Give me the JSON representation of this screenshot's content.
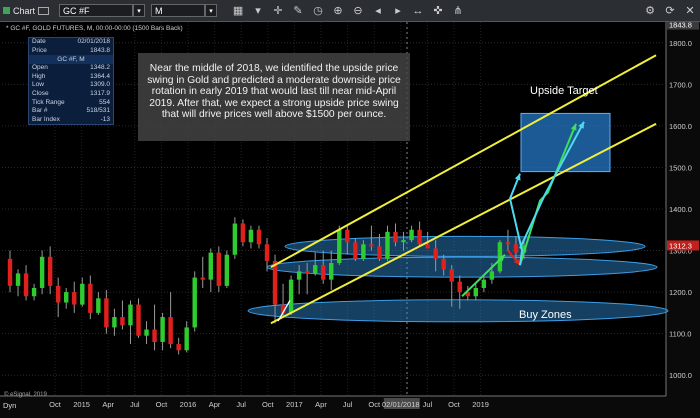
{
  "toolbar": {
    "app_label": "Chart",
    "symbol": "GC #F",
    "interval": "M"
  },
  "series_label": "* GC #F, GOLD FUTURES, M, 00:00-00:00 (1500 Bars Back)",
  "data_window": {
    "rows": [
      {
        "k": "Date",
        "v": "02/01/2018"
      },
      {
        "k": "Price",
        "v": "1843.8"
      }
    ],
    "header": "GC #F, M",
    "rows2": [
      {
        "k": "Open",
        "v": "1348.2"
      },
      {
        "k": "High",
        "v": "1364.4"
      },
      {
        "k": "Low",
        "v": "1309.0"
      },
      {
        "k": "Close",
        "v": "1317.9"
      },
      {
        "k": "Tick Range",
        "v": "554"
      },
      {
        "k": "Bar #",
        "v": "518/531"
      },
      {
        "k": "Bar Index",
        "v": "-13"
      }
    ]
  },
  "annotation": "Near the middle of 2018, we identified the upside price swing in Gold and predicted a moderate downside price rotation in early 2019 that would last till near mid-April 2019.  After that, we expect a strong upside price swing that will drive prices well above $1500 per ounce.",
  "upside_label": "Upside Target",
  "buy_label": "Buy Zones",
  "watermark": "© eSignal, 2019",
  "bottom_left": "Dyn",
  "colors": {
    "up": "#2ecc2e",
    "down": "#e0201c",
    "channel": "#f2ef3a",
    "zone": "#2f8fd8",
    "arrow_green": "#3de05a",
    "arrow_cyan": "#4fd8f2"
  },
  "chart_data": {
    "type": "candlestick",
    "ylim": [
      950,
      1850
    ],
    "y_ticks": [
      1000,
      1100,
      1200,
      1300,
      1400,
      1500,
      1600,
      1700,
      1800
    ],
    "y_tick_labels": [
      "1000.0",
      "1100.0",
      "1200.0",
      "1300.0",
      "1400.0",
      "1500.0",
      "1600.0",
      "1700.0",
      "1800.0"
    ],
    "price_marker_top": "1843.8",
    "price_marker_last": "1312.3",
    "x_tick_labels": [
      "Oct",
      "2015",
      "Apr",
      "Jul",
      "Oct",
      "2016",
      "Apr",
      "Jul",
      "Oct",
      "2017",
      "Apr",
      "Jul",
      "Oct",
      "02/01/2018",
      "Jul",
      "Oct",
      "2019"
    ],
    "grid": true,
    "candles": [
      {
        "o": 1280,
        "h": 1300,
        "l": 1200,
        "c": 1215
      },
      {
        "o": 1215,
        "h": 1255,
        "l": 1190,
        "c": 1245
      },
      {
        "o": 1245,
        "h": 1265,
        "l": 1180,
        "c": 1190
      },
      {
        "o": 1190,
        "h": 1220,
        "l": 1180,
        "c": 1210
      },
      {
        "o": 1210,
        "h": 1300,
        "l": 1195,
        "c": 1285
      },
      {
        "o": 1285,
        "h": 1310,
        "l": 1195,
        "c": 1215
      },
      {
        "o": 1215,
        "h": 1235,
        "l": 1140,
        "c": 1175
      },
      {
        "o": 1175,
        "h": 1210,
        "l": 1160,
        "c": 1200
      },
      {
        "o": 1200,
        "h": 1225,
        "l": 1150,
        "c": 1170
      },
      {
        "o": 1170,
        "h": 1235,
        "l": 1165,
        "c": 1220
      },
      {
        "o": 1220,
        "h": 1240,
        "l": 1135,
        "c": 1150
      },
      {
        "o": 1150,
        "h": 1200,
        "l": 1145,
        "c": 1185
      },
      {
        "o": 1185,
        "h": 1205,
        "l": 1100,
        "c": 1115
      },
      {
        "o": 1115,
        "h": 1160,
        "l": 1095,
        "c": 1140
      },
      {
        "o": 1140,
        "h": 1180,
        "l": 1110,
        "c": 1120
      },
      {
        "o": 1120,
        "h": 1180,
        "l": 1075,
        "c": 1170
      },
      {
        "o": 1170,
        "h": 1185,
        "l": 1090,
        "c": 1095
      },
      {
        "o": 1095,
        "h": 1130,
        "l": 1075,
        "c": 1110
      },
      {
        "o": 1110,
        "h": 1170,
        "l": 1060,
        "c": 1080
      },
      {
        "o": 1080,
        "h": 1150,
        "l": 1060,
        "c": 1140
      },
      {
        "o": 1140,
        "h": 1200,
        "l": 1065,
        "c": 1075
      },
      {
        "o": 1075,
        "h": 1090,
        "l": 1050,
        "c": 1060
      },
      {
        "o": 1060,
        "h": 1130,
        "l": 1055,
        "c": 1115
      },
      {
        "o": 1115,
        "h": 1250,
        "l": 1105,
        "c": 1235
      },
      {
        "o": 1235,
        "h": 1285,
        "l": 1210,
        "c": 1230
      },
      {
        "o": 1230,
        "h": 1305,
        "l": 1200,
        "c": 1295
      },
      {
        "o": 1295,
        "h": 1310,
        "l": 1200,
        "c": 1215
      },
      {
        "o": 1215,
        "h": 1300,
        "l": 1210,
        "c": 1290
      },
      {
        "o": 1290,
        "h": 1380,
        "l": 1280,
        "c": 1365
      },
      {
        "o": 1365,
        "h": 1375,
        "l": 1310,
        "c": 1320
      },
      {
        "o": 1320,
        "h": 1360,
        "l": 1305,
        "c": 1350
      },
      {
        "o": 1350,
        "h": 1360,
        "l": 1305,
        "c": 1315
      },
      {
        "o": 1315,
        "h": 1330,
        "l": 1250,
        "c": 1275
      },
      {
        "o": 1275,
        "h": 1290,
        "l": 1125,
        "c": 1170
      },
      {
        "o": 1170,
        "h": 1220,
        "l": 1140,
        "c": 1150
      },
      {
        "o": 1150,
        "h": 1240,
        "l": 1145,
        "c": 1230
      },
      {
        "o": 1230,
        "h": 1265,
        "l": 1195,
        "c": 1250
      },
      {
        "o": 1250,
        "h": 1270,
        "l": 1195,
        "c": 1245
      },
      {
        "o": 1245,
        "h": 1295,
        "l": 1240,
        "c": 1265
      },
      {
        "o": 1265,
        "h": 1300,
        "l": 1220,
        "c": 1230
      },
      {
        "o": 1230,
        "h": 1300,
        "l": 1205,
        "c": 1270
      },
      {
        "o": 1270,
        "h": 1360,
        "l": 1265,
        "c": 1350
      },
      {
        "o": 1350,
        "h": 1360,
        "l": 1290,
        "c": 1320
      },
      {
        "o": 1320,
        "h": 1330,
        "l": 1275,
        "c": 1280
      },
      {
        "o": 1280,
        "h": 1325,
        "l": 1275,
        "c": 1315
      },
      {
        "o": 1315,
        "h": 1360,
        "l": 1300,
        "c": 1310
      },
      {
        "o": 1310,
        "h": 1340,
        "l": 1275,
        "c": 1280
      },
      {
        "o": 1280,
        "h": 1360,
        "l": 1275,
        "c": 1345
      },
      {
        "o": 1345,
        "h": 1365,
        "l": 1310,
        "c": 1320
      },
      {
        "o": 1320,
        "h": 1345,
        "l": 1300,
        "c": 1325
      },
      {
        "o": 1325,
        "h": 1360,
        "l": 1320,
        "c": 1350
      },
      {
        "o": 1350,
        "h": 1370,
        "l": 1310,
        "c": 1315
      },
      {
        "o": 1315,
        "h": 1345,
        "l": 1305,
        "c": 1305
      },
      {
        "o": 1305,
        "h": 1325,
        "l": 1250,
        "c": 1280
      },
      {
        "o": 1280,
        "h": 1290,
        "l": 1240,
        "c": 1255
      },
      {
        "o": 1255,
        "h": 1265,
        "l": 1165,
        "c": 1225
      },
      {
        "o": 1225,
        "h": 1240,
        "l": 1160,
        "c": 1200
      },
      {
        "o": 1200,
        "h": 1215,
        "l": 1180,
        "c": 1190
      },
      {
        "o": 1190,
        "h": 1220,
        "l": 1180,
        "c": 1210
      },
      {
        "o": 1210,
        "h": 1240,
        "l": 1200,
        "c": 1230
      },
      {
        "o": 1230,
        "h": 1270,
        "l": 1220,
        "c": 1250
      },
      {
        "o": 1250,
        "h": 1325,
        "l": 1245,
        "c": 1320
      },
      {
        "o": 1320,
        "h": 1350,
        "l": 1300,
        "c": 1315
      },
      {
        "o": 1315,
        "h": 1335,
        "l": 1280,
        "c": 1295
      },
      {
        "o": 1295,
        "h": 1330,
        "l": 1280,
        "c": 1312
      }
    ],
    "annotations": [
      {
        "type": "channel_upper",
        "from": [
          0.405,
          1260
        ],
        "to": [
          0.985,
          1770
        ]
      },
      {
        "type": "channel_lower",
        "from": [
          0.405,
          1125
        ],
        "to": [
          0.985,
          1605
        ]
      },
      {
        "type": "zone",
        "center": [
          0.475,
          1310
        ],
        "label": "Buy Zone"
      },
      {
        "type": "zone",
        "center": [
          0.6,
          1260
        ],
        "label": "Buy Zone"
      },
      {
        "type": "zone",
        "center": [
          0.6,
          1155
        ],
        "label": "Buy Zone"
      },
      {
        "type": "target_box",
        "range": [
          1490,
          1630
        ],
        "label": "Upside Target"
      }
    ]
  }
}
